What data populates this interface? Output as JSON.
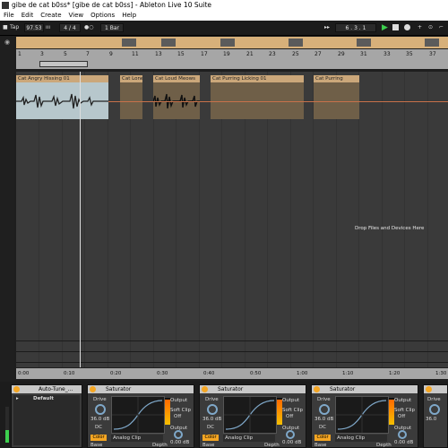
{
  "window": {
    "title": "gibe de cat b0ss* [gibe de cat b0ss] - Ableton Live 10 Suite"
  },
  "menu": [
    "File",
    "Edit",
    "Create",
    "View",
    "Options",
    "Help"
  ],
  "transport": {
    "tap": "Tap",
    "tempo": "97.53",
    "signature": "4 / 4",
    "quantize": "1 Bar",
    "position": "6 . 3 . 1"
  },
  "ruler": {
    "bars": [
      "1",
      "3",
      "5",
      "7",
      "9",
      "11",
      "13",
      "15",
      "17",
      "19",
      "21",
      "23",
      "25",
      "27",
      "29",
      "31",
      "33",
      "35",
      "37"
    ]
  },
  "clips": [
    {
      "name": "Cat Angry Hissing 01",
      "selected": true
    },
    {
      "name": "Cat Lonel",
      "selected": false
    },
    {
      "name": "Cat Loud Meows",
      "selected": false
    },
    {
      "name": "Cat Purring Licking 01",
      "selected": false
    },
    {
      "name": "Cat Purring",
      "selected": false
    }
  ],
  "drop_hint": "Drop Files and Devices Here",
  "time_ruler": [
    "0:00",
    "0:10",
    "0:20",
    "0:30",
    "0:40",
    "0:50",
    "1:00",
    "1:10",
    "1:20",
    "1:30"
  ],
  "devices": {
    "rack": {
      "title": "Auto-Tune_...",
      "preset": "Default"
    },
    "saturators": [
      {
        "title": "Saturator",
        "drive_label": "Drive",
        "drive_value": "36.0 dB",
        "dc": "DC",
        "color": "Color",
        "mode": "Analog Clip",
        "output_label": "Output",
        "softclip_label": "Soft Clip",
        "softclip_value": "Off",
        "output_value": "0.00 dB",
        "base": "Base",
        "depth": "Depth"
      },
      {
        "title": "Saturator",
        "drive_label": "Drive",
        "drive_value": "36.0 dB",
        "dc": "DC",
        "color": "Color",
        "mode": "Analog Clip",
        "output_label": "Output",
        "softclip_label": "Soft Clip",
        "softclip_value": "Off",
        "output_value": "0.00 dB",
        "base": "Base",
        "depth": "Depth"
      },
      {
        "title": "Saturator",
        "drive_label": "Drive",
        "drive_value": "36.0 dB",
        "dc": "DC",
        "color": "Color",
        "mode": "Analog Clip",
        "output_label": "Output",
        "softclip_label": "Soft Clip",
        "softclip_value": "Off",
        "output_value": "0.00 dB",
        "base": "Base",
        "depth": "Depth"
      }
    ],
    "partial": {
      "drive_label": "Drive",
      "drive_value": "36.0"
    }
  },
  "colors": {
    "accent": "#f5a623",
    "clip": "#cba77a",
    "selected_clip_body": "#b7c7cc"
  }
}
